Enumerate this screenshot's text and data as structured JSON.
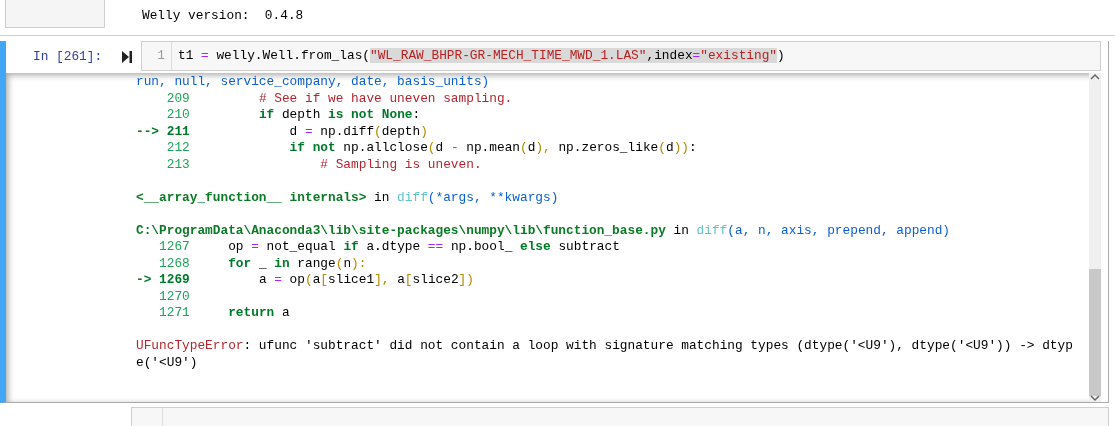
{
  "previous_output": {
    "text": "Welly version:  0.4.8"
  },
  "cell": {
    "prompt": "In [261]:",
    "input": {
      "line_number": "1",
      "code": [
        {
          "text": "t1 ",
          "kind": "plain",
          "selected": false
        },
        {
          "text": "=",
          "kind": "op",
          "selected": false
        },
        {
          "text": " welly.Well.from_las",
          "kind": "plain",
          "selected": false
        },
        {
          "text": "(",
          "kind": "plain",
          "selected": false
        },
        {
          "text": "\"WL_RAW_BHPR-GR-MECH_TIME_MWD_1.LAS\"",
          "kind": "string",
          "selected": true
        },
        {
          "text": ",index",
          "kind": "plain",
          "selected": true
        },
        {
          "text": "=",
          "kind": "op",
          "selected": true
        },
        {
          "text": "\"existing\"",
          "kind": "string",
          "selected": true
        },
        {
          "text": ")",
          "kind": "plain",
          "selected": false
        }
      ]
    },
    "output": [
      [
        [
          {
            "text": "run, null, service_company, date, basis_units)",
            "kind": "args"
          }
        ],
        [
          {
            "text": "    209",
            "kind": "lineno"
          },
          {
            "text": "         # See if we have uneven sampling.",
            "kind": "comment"
          }
        ],
        [
          {
            "text": "    210",
            "kind": "lineno"
          },
          {
            "text": "         if",
            "kind": "keyword"
          },
          {
            "text": " depth ",
            "kind": "plain"
          },
          {
            "text": "is not None",
            "kind": "keyword"
          },
          {
            "text": ":",
            "kind": "plain"
          }
        ],
        [
          {
            "text": "--> 211",
            "kind": "arrow"
          },
          {
            "text": "             d ",
            "kind": "plain"
          },
          {
            "text": "=",
            "kind": "op"
          },
          {
            "text": " np.diff",
            "kind": "plain"
          },
          {
            "text": "(",
            "kind": "bracket"
          },
          {
            "text": "depth",
            "kind": "plain"
          },
          {
            "text": ")",
            "kind": "bracket"
          }
        ],
        [
          {
            "text": "    212",
            "kind": "lineno"
          },
          {
            "text": "             if not",
            "kind": "keyword"
          },
          {
            "text": " np.allclose",
            "kind": "plain"
          },
          {
            "text": "(",
            "kind": "bracket"
          },
          {
            "text": "d ",
            "kind": "plain"
          },
          {
            "text": "-",
            "kind": "op"
          },
          {
            "text": " np.mean",
            "kind": "plain"
          },
          {
            "text": "(",
            "kind": "bracket"
          },
          {
            "text": "d",
            "kind": "plain"
          },
          {
            "text": "),",
            "kind": "bracket"
          },
          {
            "text": " np.zeros_like",
            "kind": "plain"
          },
          {
            "text": "(",
            "kind": "bracket"
          },
          {
            "text": "d",
            "kind": "plain"
          },
          {
            "text": "))",
            "kind": "bracket"
          },
          {
            "text": ":",
            "kind": "plain"
          }
        ],
        [
          {
            "text": "    213",
            "kind": "lineno"
          },
          {
            "text": "                 # Sampling is uneven.",
            "kind": "comment"
          }
        ]
      ],
      [
        [
          {
            "text": "<__array_function__ internals>",
            "kind": "path"
          },
          {
            "text": " in ",
            "kind": "plain"
          },
          {
            "text": "diff",
            "kind": "func"
          },
          {
            "text": "(*args, **kwargs)",
            "kind": "args"
          }
        ]
      ],
      [
        [
          {
            "text": "C:\\ProgramData\\Anaconda3\\lib\\site-packages\\numpy\\lib\\function_base.py",
            "kind": "path"
          },
          {
            "text": " in ",
            "kind": "plain"
          },
          {
            "text": "diff",
            "kind": "func"
          },
          {
            "text": "(a, n, axis, prepend, append)",
            "kind": "args"
          }
        ],
        [
          {
            "text": "   1267",
            "kind": "lineno"
          },
          {
            "text": "     op ",
            "kind": "plain"
          },
          {
            "text": "=",
            "kind": "op"
          },
          {
            "text": " not_equal ",
            "kind": "plain"
          },
          {
            "text": "if",
            "kind": "keyword"
          },
          {
            "text": " a.dtype ",
            "kind": "plain"
          },
          {
            "text": "==",
            "kind": "op"
          },
          {
            "text": " np.bool_ ",
            "kind": "plain"
          },
          {
            "text": "else",
            "kind": "keyword"
          },
          {
            "text": " subtract",
            "kind": "plain"
          }
        ],
        [
          {
            "text": "   1268",
            "kind": "lineno"
          },
          {
            "text": "     for",
            "kind": "keyword"
          },
          {
            "text": " _ ",
            "kind": "plain"
          },
          {
            "text": "in",
            "kind": "keyword"
          },
          {
            "text": " range",
            "kind": "plain"
          },
          {
            "text": "(",
            "kind": "bracket"
          },
          {
            "text": "n",
            "kind": "plain"
          },
          {
            "text": "):",
            "kind": "bracket"
          }
        ],
        [
          {
            "text": "-> 1269",
            "kind": "arrow"
          },
          {
            "text": "         a ",
            "kind": "plain"
          },
          {
            "text": "=",
            "kind": "op"
          },
          {
            "text": " op",
            "kind": "plain"
          },
          {
            "text": "(",
            "kind": "bracket"
          },
          {
            "text": "a",
            "kind": "plain"
          },
          {
            "text": "[",
            "kind": "bracket"
          },
          {
            "text": "slice1",
            "kind": "plain"
          },
          {
            "text": "],",
            "kind": "bracket"
          },
          {
            "text": " a",
            "kind": "plain"
          },
          {
            "text": "[",
            "kind": "bracket"
          },
          {
            "text": "slice2",
            "kind": "plain"
          },
          {
            "text": "])",
            "kind": "bracket"
          }
        ],
        [
          {
            "text": "   1270",
            "kind": "lineno"
          }
        ],
        [
          {
            "text": "   1271",
            "kind": "lineno"
          },
          {
            "text": "     return",
            "kind": "keyword"
          },
          {
            "text": " a",
            "kind": "plain"
          }
        ]
      ],
      [
        [
          {
            "text": "UFuncTypeError",
            "kind": "error"
          },
          {
            "text": ": ufunc 'subtract' did not contain a loop with signature matching types (dtype('<U9'), dtype('<U9')) -> dtyp",
            "kind": "plain"
          }
        ],
        [
          {
            "text": "e('<U9')",
            "kind": "plain"
          }
        ]
      ]
    ]
  }
}
